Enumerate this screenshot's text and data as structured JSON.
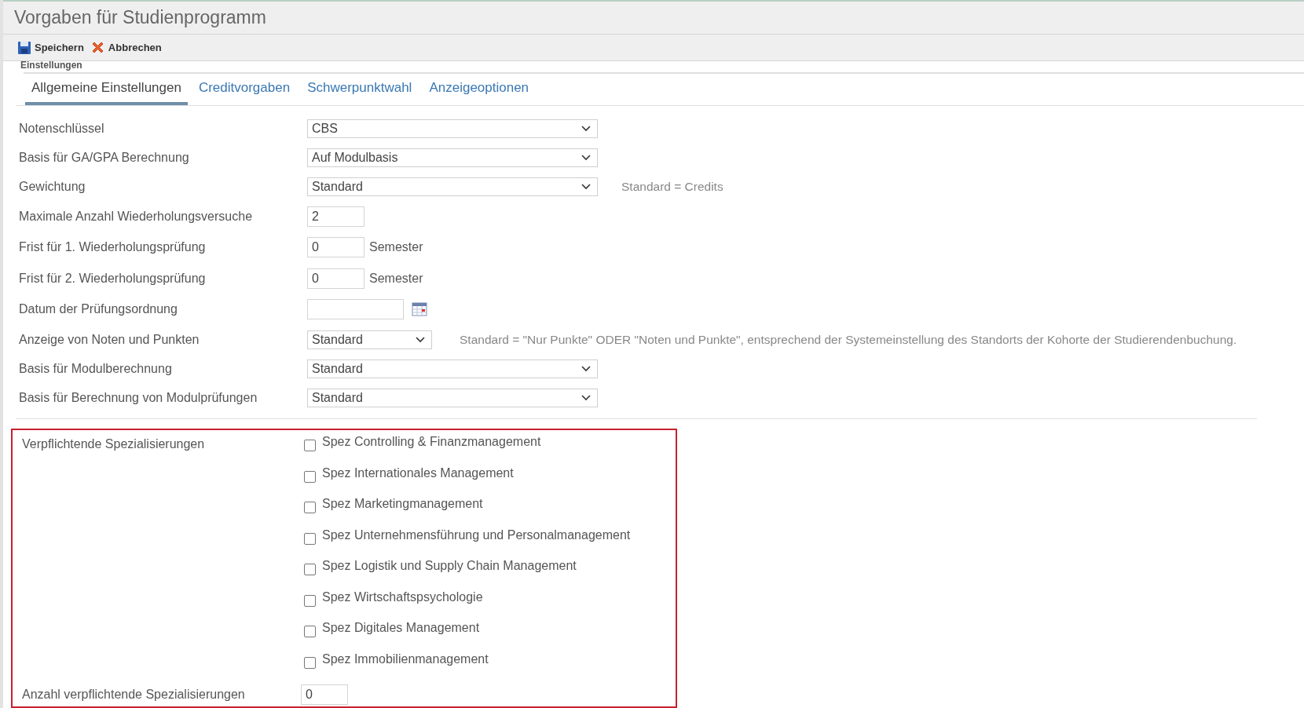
{
  "window": {
    "title": "Vorgaben für Studienprogramm"
  },
  "toolbar": [
    {
      "kind": "save",
      "label": "Speichern"
    },
    {
      "kind": "cancel",
      "label": "Abbrechen"
    }
  ],
  "section_title": "Einstellungen",
  "tabs": [
    {
      "label": "Allgemeine Einstellungen",
      "selected": true
    },
    {
      "label": "Creditvorgaben",
      "selected": false
    },
    {
      "label": "Schwerpunktwahl",
      "selected": false
    },
    {
      "label": "Anzeigeoptionen",
      "selected": false
    }
  ],
  "fields": [
    {
      "kind": "select",
      "label": "Notenschlüssel",
      "value": "CBS"
    },
    {
      "kind": "select",
      "label": "Basis für GA/GPA Berechnung",
      "value": "Auf Modulbasis"
    },
    {
      "kind": "select",
      "label": "Gewichtung",
      "value": "Standard",
      "hint": "Standard = Credits"
    },
    {
      "kind": "number",
      "label": "Maximale Anzahl Wiederholungsversuche",
      "value": "2"
    },
    {
      "kind": "number",
      "label": "Frist für 1. Wiederholungsprüfung",
      "value": "0",
      "suffix": "Semester"
    },
    {
      "kind": "number",
      "label": "Frist für 2. Wiederholungsprüfung",
      "value": "0",
      "suffix": "Semester"
    },
    {
      "kind": "date",
      "label": "Datum der Prüfungsordnung"
    },
    {
      "kind": "select_small",
      "label": "Anzeige von Noten und Punkten",
      "value": "Standard",
      "hint": "Standard = \"Nur Punkte\" ODER \"Noten und Punkte\", entsprechend der Systemeinstellung des Standorts der Kohorte der Studierendenbuchung."
    },
    {
      "kind": "select",
      "label": "Basis für Modulberechnung",
      "value": "Standard"
    },
    {
      "kind": "select",
      "label": "Basis für Berechnung von Modulprüfungen",
      "value": "Standard"
    }
  ],
  "specializations": {
    "label": "Verpflichtende Spezialisierungen",
    "options": [
      {
        "label": "Spez Controlling & Finanzmanagement",
        "checked": false
      },
      {
        "label": "Spez Internationales Management",
        "checked": false
      },
      {
        "label": "Spez Marketingmanagement",
        "checked": false
      },
      {
        "label": "Spez Unternehmensführung und Personalmanagement",
        "checked": false
      },
      {
        "label": "Spez Logistik und Supply Chain Management",
        "checked": false
      },
      {
        "label": "Spez Wirtschaftspsychologie",
        "checked": false
      },
      {
        "label": "Spez Digitales Management",
        "checked": false
      },
      {
        "label": "Spez Immobilienmanagement",
        "checked": false
      }
    ],
    "count_label": "Anzahl verpflichtende Spezialisierungen",
    "count_value": "0"
  }
}
